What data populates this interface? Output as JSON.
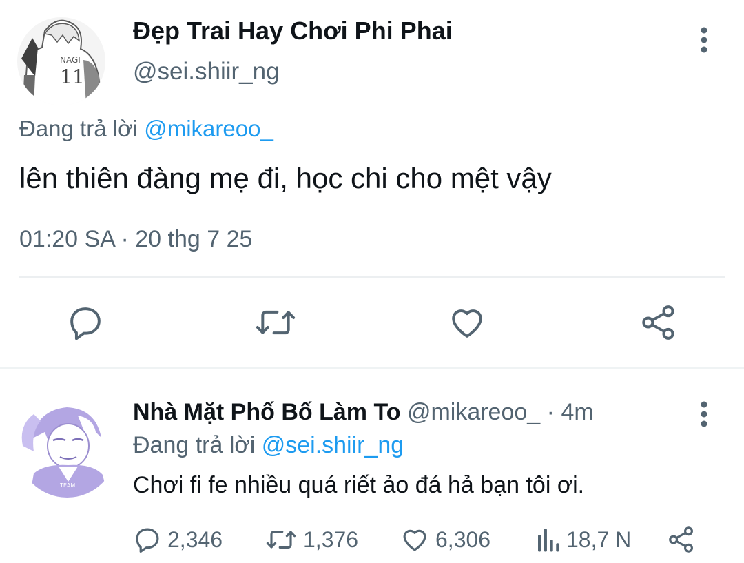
{
  "main_tweet": {
    "display_name": "Đẹp Trai Hay Chơi Phi Phai",
    "handle": "@sei.shiir_ng",
    "replying_prefix": "Đang trả lời",
    "replying_to": "@mikareoo_",
    "text": "lên thiên đàng mẹ đi, học chi cho mệt vậy",
    "time": "01:20 SA",
    "dot": "·",
    "date": "20 thg 7 25",
    "avatar_jersey_text": "NAGI",
    "avatar_jersey_number": "11",
    "icons": [
      "more-vertical-icon",
      "reply-icon",
      "retweet-icon",
      "like-icon",
      "share-icon"
    ]
  },
  "reply_tweet": {
    "display_name": "Nhà Mặt Phố Bố Làm To",
    "handle": "@mikareoo_",
    "separator": "·",
    "time_ago": "4m",
    "replying_prefix": "Đang trả lời",
    "replying_to": "@sei.shiir_ng",
    "text": "Chơi fi fe nhiều quá riết ảo đá hả bạn tôi ơi.",
    "stats": {
      "replies": "2,346",
      "retweets": "1,376",
      "likes": "6,306",
      "views": "18,7 N"
    },
    "avatar_jersey_text": "TEAM",
    "icons": [
      "more-vertical-icon",
      "reply-icon",
      "retweet-icon",
      "like-icon",
      "views-icon",
      "share-icon"
    ]
  },
  "colors": {
    "text_primary": "#0f1419",
    "text_secondary": "#536471",
    "mention": "#1d9bf0",
    "divider": "#eff3f4",
    "avatar_reply_tint": "#b3a6e3"
  }
}
